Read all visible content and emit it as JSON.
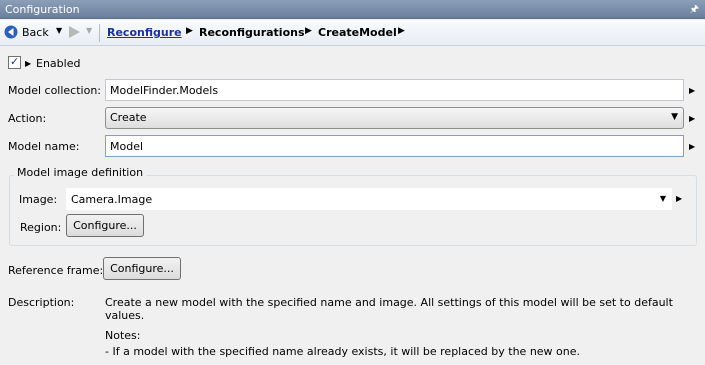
{
  "titlebar": {
    "title": "Configuration"
  },
  "nav": {
    "back_label": "Back",
    "breadcrumbs": [
      "Reconfigure",
      "Reconfigurations",
      "CreateModel"
    ]
  },
  "enabled": {
    "label": "Enabled",
    "checked": true
  },
  "model_collection": {
    "label": "Model collection:",
    "value": "ModelFinder.Models"
  },
  "action": {
    "label": "Action:",
    "value": "Create"
  },
  "model_name": {
    "label": "Model name:",
    "value": "Model"
  },
  "model_image_definition": {
    "title": "Model image definition",
    "image_label": "Image:",
    "image_value": "Camera.Image",
    "region_label": "Region:",
    "region_button": "Configure..."
  },
  "reference_frame": {
    "label": "Reference frame:",
    "button": "Configure..."
  },
  "description": {
    "label": "Description:",
    "text": "Create a new model with the specified name and image. All settings of this model will be set to default values.",
    "notes_heading": "Notes:",
    "note_1": "- If a model with the specified name already exists, it will be replaced by the new one."
  }
}
